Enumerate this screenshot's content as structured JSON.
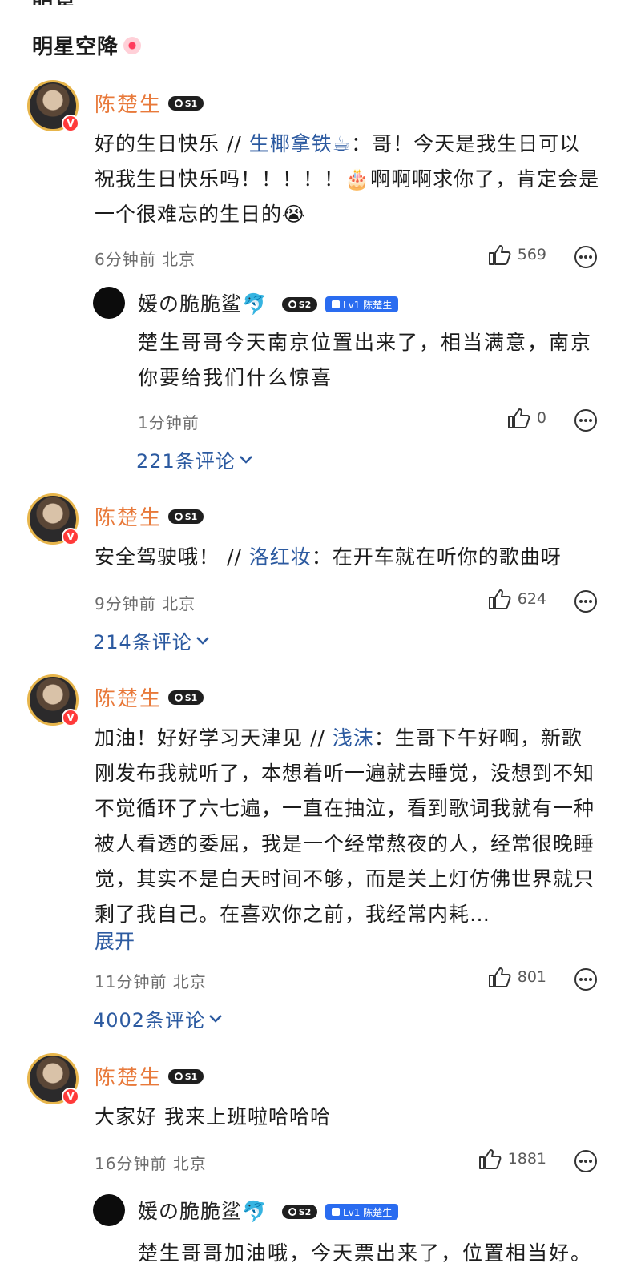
{
  "header": {
    "cut_title": "明星",
    "section_title": "明星空降"
  },
  "posts": [
    {
      "username": "陈楚生",
      "level": "S1",
      "reply_text": "好的生日快乐 // ",
      "quoted_user": "生椰拿铁☕",
      "quoted_text": "：哥！今天是我生日可以祝我生日快乐吗！！！！！🎂啊啊啊求你了，肯定会是一个很难忘的生日的😭",
      "time_location": "6分钟前  北京",
      "likes": "569",
      "sub_reply": {
        "username": "媛の脆脆鲨🐬",
        "level": "S2",
        "fan_badge": "Lv1 陈楚生",
        "text": "楚生哥哥今天南京位置出来了，相当满意，南京你要给我们什么惊喜",
        "time": "1分钟前",
        "likes": "0"
      },
      "replies_count": "221条评论"
    },
    {
      "username": "陈楚生",
      "level": "S1",
      "reply_text": "安全驾驶哦！ // ",
      "quoted_user": "洛红妆",
      "quoted_text": "：在开车就在听你的歌曲呀",
      "time_location": "9分钟前  北京",
      "likes": "624",
      "replies_count": "214条评论"
    },
    {
      "username": "陈楚生",
      "level": "S1",
      "reply_text": "加油！好好学习天津见 // ",
      "quoted_user": "浅沫",
      "quoted_text": "：生哥下午好啊，新歌刚发布我就听了，本想着听一遍就去睡觉，没想到不知不觉循环了六七遍，一直在抽泣，看到歌词我就有一种被人看透的委屈，我是一个经常熬夜的人，经常很晚睡觉，其实不是白天时间不够，而是关上灯仿佛世界就只剩了我自己。在喜欢你之前，我经常内耗…",
      "expand": "展开",
      "time_location": "11分钟前  北京",
      "likes": "801",
      "replies_count": "4002条评论"
    },
    {
      "username": "陈楚生",
      "level": "S1",
      "reply_text": "大家好 我来上班啦哈哈哈",
      "time_location": "16分钟前  北京",
      "likes": "1881",
      "sub_reply": {
        "username": "媛の脆脆鲨🐬",
        "level": "S2",
        "fan_badge": "Lv1 陈楚生",
        "text": "楚生哥哥加油哦，今天票出来了，位置相当好。"
      }
    }
  ]
}
